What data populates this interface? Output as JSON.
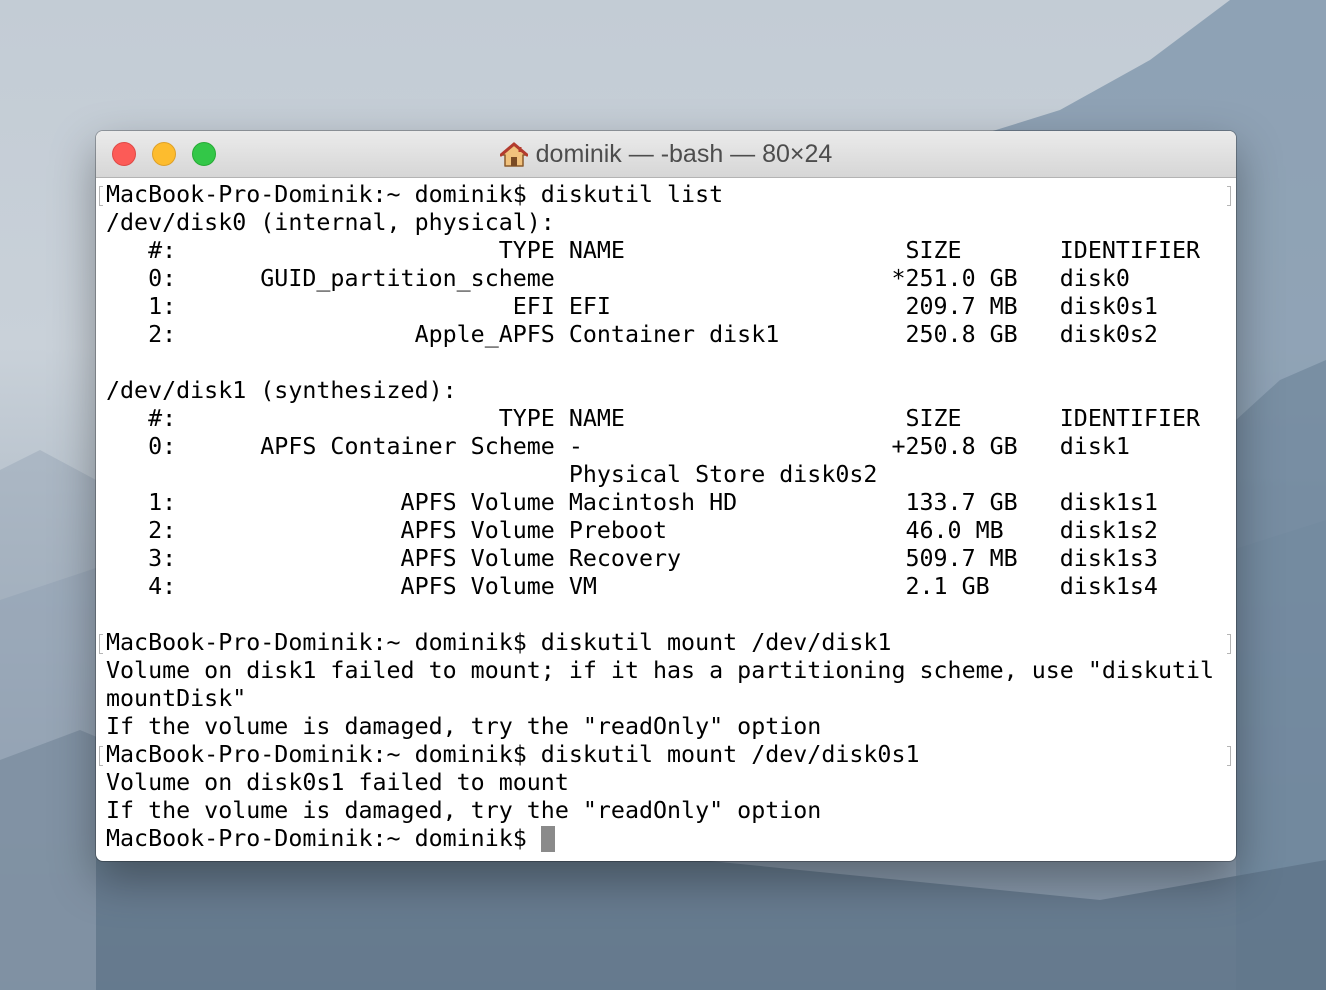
{
  "window": {
    "title": "dominik — -bash — 80×24",
    "icon": "home-icon"
  },
  "terminal": {
    "lines": [
      "MacBook-Pro-Dominik:~ dominik$ diskutil list",
      "/dev/disk0 (internal, physical):",
      "   #:                       TYPE NAME                    SIZE       IDENTIFIER",
      "   0:      GUID_partition_scheme                        *251.0 GB   disk0",
      "   1:                        EFI EFI                     209.7 MB   disk0s1",
      "   2:                 Apple_APFS Container disk1         250.8 GB   disk0s2",
      "",
      "/dev/disk1 (synthesized):",
      "   #:                       TYPE NAME                    SIZE       IDENTIFIER",
      "   0:      APFS Container Scheme -                      +250.8 GB   disk1",
      "                                 Physical Store disk0s2",
      "   1:                APFS Volume Macintosh HD            133.7 GB   disk1s1",
      "   2:                APFS Volume Preboot                 46.0 MB    disk1s2",
      "   3:                APFS Volume Recovery                509.7 MB   disk1s3",
      "   4:                APFS Volume VM                      2.1 GB     disk1s4",
      "",
      "MacBook-Pro-Dominik:~ dominik$ diskutil mount /dev/disk1",
      "Volume on disk1 failed to mount; if it has a partitioning scheme, use \"diskutil",
      "mountDisk\"",
      "If the volume is damaged, try the \"readOnly\" option",
      "MacBook-Pro-Dominik:~ dominik$ diskutil mount /dev/disk0s1",
      "Volume on disk0s1 failed to mount",
      "If the volume is damaged, try the \"readOnly\" option",
      "MacBook-Pro-Dominik:~ dominik$ "
    ]
  }
}
